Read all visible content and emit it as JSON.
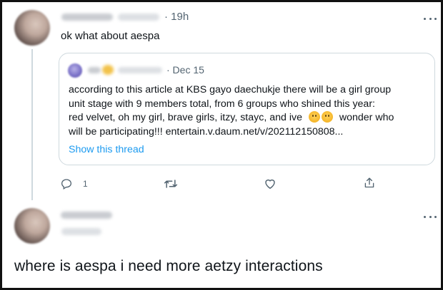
{
  "first_tweet": {
    "time": "· 19h",
    "text": "ok what about aespa"
  },
  "quoted_tweet": {
    "date": "· Dec 15",
    "lines": [
      "according to this article at KBS gayo daechukje there will be a girl group",
      "unit stage with 9 members total, from 6 groups who shined this year:",
      "red velvet, oh my girl, brave girls, itzy, stayc, and ive",
      "wonder who",
      "will be participating!!! entertain.v.daum.net/v/202112150808..."
    ],
    "show_thread": "Show this thread"
  },
  "actions": {
    "reply_count": "1"
  },
  "second_tweet": {
    "text": "where is aespa i need more aetzy interactions"
  },
  "icons": [
    "reply-icon",
    "retweet-icon",
    "like-icon",
    "share-icon",
    "more-icon",
    "thinking-face-emoji"
  ],
  "colors": {
    "link": "#1d9bf0",
    "secondary": "#536471",
    "border": "#cfd9de"
  }
}
